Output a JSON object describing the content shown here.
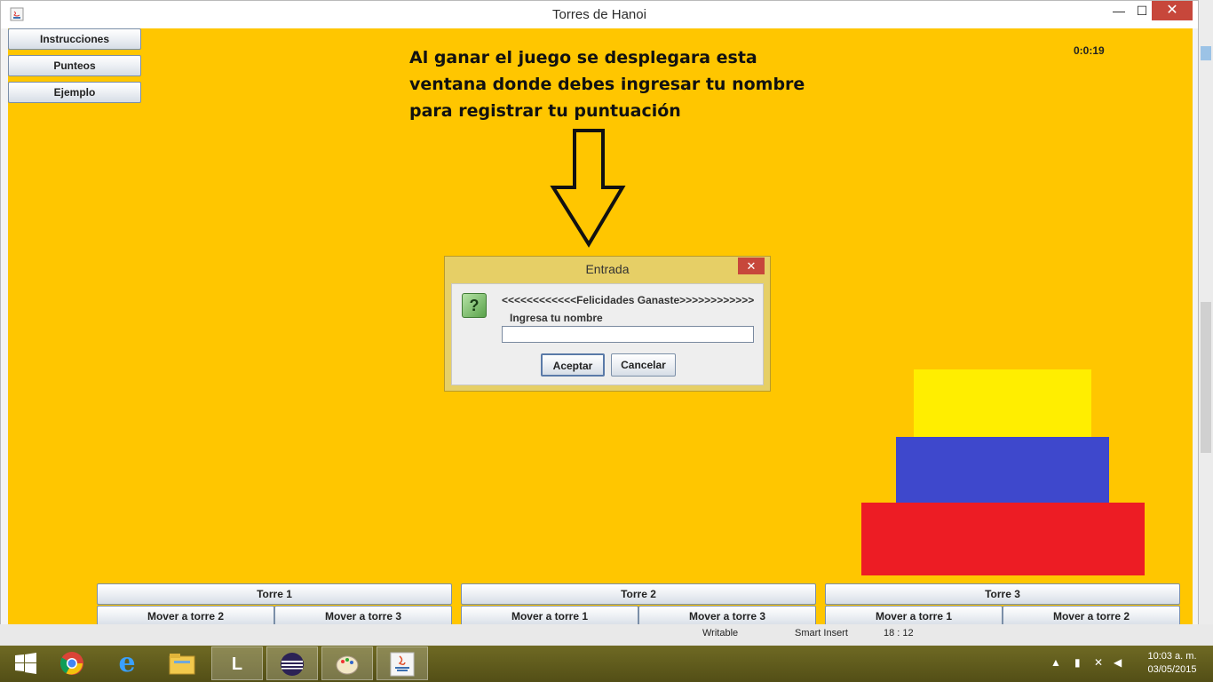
{
  "window": {
    "title": "Torres de Hanoi"
  },
  "titlebar_buttons": {
    "minimize": "—",
    "maximize": "☐",
    "close": "✕"
  },
  "side_buttons": [
    "Instrucciones",
    "Punteos",
    "Ejemplo"
  ],
  "timer": "0:0:19",
  "annotation": {
    "lines": [
      "Al ganar el juego se desplegara esta",
      "ventana donde debes ingresar tu nombre",
      "para registrar tu puntuación"
    ]
  },
  "discs": [
    {
      "color": "#ffee00",
      "size": "small"
    },
    {
      "color": "#3e48cc",
      "size": "medium"
    },
    {
      "color": "#ed1c24",
      "size": "large"
    }
  ],
  "dialog": {
    "title": "Entrada",
    "close": "✕",
    "icon": "?",
    "message": "<<<<<<<<<<<<Felicidades Ganaste>>>>>>>>>>>>",
    "label": "Ingresa tu nombre",
    "input_value": "",
    "ok": "Aceptar",
    "cancel": "Cancelar"
  },
  "towers": [
    {
      "label": "Torre 1",
      "move_a": "Mover a torre 2",
      "move_b": "Mover a torre 3"
    },
    {
      "label": "Torre 2",
      "move_a": "Mover a torre 1",
      "move_b": "Mover a torre 3"
    },
    {
      "label": "Torre 3",
      "move_a": "Mover a torre 1",
      "move_b": "Mover a torre 2"
    }
  ],
  "status_bar": {
    "writable": "Writable",
    "insert_mode": "Smart Insert",
    "position": "18 : 12"
  },
  "taskbar": {
    "apps": [
      "windows-start",
      "chrome",
      "internet-explorer",
      "file-explorer",
      "lync",
      "eclipse",
      "paint",
      "java"
    ],
    "clock_time": "10:03 a. m.",
    "clock_date": "03/05/2015"
  },
  "colors": {
    "game_background": "#ffc600",
    "dialog_frame": "#e6cf66"
  }
}
